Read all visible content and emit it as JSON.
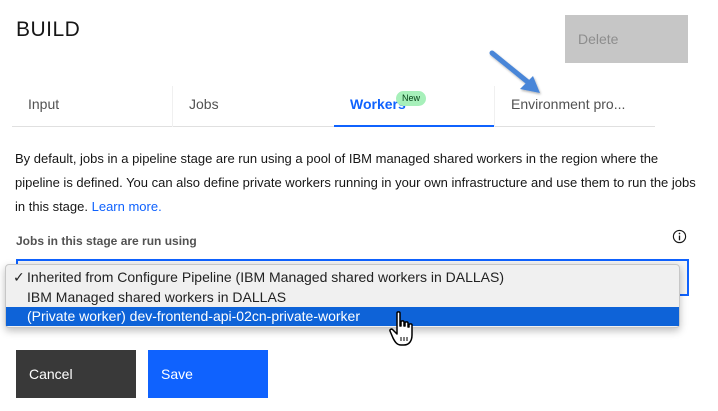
{
  "page": {
    "title": "BUILD",
    "delete_label": "Delete"
  },
  "tabs": [
    {
      "label": "Input"
    },
    {
      "label": "Jobs"
    },
    {
      "label": "Workers",
      "badge": "New"
    },
    {
      "label": "Environment pro..."
    }
  ],
  "description": {
    "text": "By default, jobs in a pipeline stage are run using a pool of IBM managed shared workers in the region where the pipeline is defined. You can also define private workers running in your own infrastructure and use them to run the jobs in this stage. ",
    "link": "Learn more."
  },
  "field": {
    "label": "Jobs in this stage are run using",
    "info_icon": "info-icon"
  },
  "dropdown": {
    "options": [
      {
        "label": "Inherited from Configure Pipeline (IBM Managed shared workers in DALLAS)",
        "checked": true,
        "check_mark": "✓"
      },
      {
        "label": "IBM Managed shared workers in DALLAS",
        "checked": false
      },
      {
        "label": "(Private worker) dev-frontend-api-02cn-private-worker",
        "highlighted": true
      }
    ]
  },
  "actions": {
    "cancel_label": "Cancel",
    "save_label": "Save"
  },
  "colors": {
    "accent": "#0f62fe",
    "highlight": "#0e63d8",
    "badge_bg": "#a7f0ba",
    "arrow": "#4a86d8"
  },
  "annotations": {
    "arrow_icon": "pointer-arrow-icon",
    "cursor_icon": "hand-cursor-icon"
  }
}
